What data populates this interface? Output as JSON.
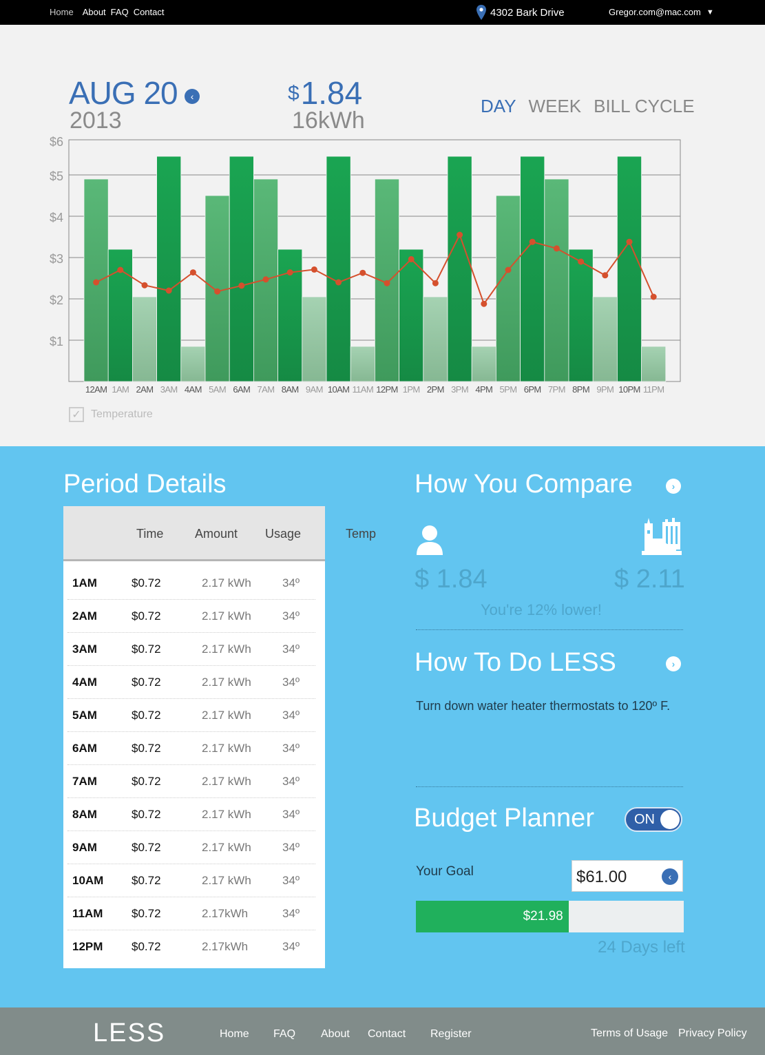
{
  "topbar": {
    "nav": [
      "Home",
      "About",
      "FAQ",
      "Contact"
    ],
    "address": "4302 Bark Drive",
    "user": "Gregor.com@mac.com",
    "caret": "▼"
  },
  "summary": {
    "date": "AUG 20",
    "year": "2013",
    "back_icon": "‹",
    "currency": "$",
    "amount": "1.84",
    "energy": "16kWh",
    "ranges": [
      "DAY",
      "WEEK",
      "BILL CYCLE"
    ],
    "active_range": "DAY"
  },
  "chart_data": {
    "type": "bar",
    "categories": [
      "12AM",
      "1AM",
      "2AM",
      "3AM",
      "4AM",
      "5AM",
      "6AM",
      "7AM",
      "8AM",
      "9AM",
      "10AM",
      "11AM",
      "12PM",
      "1PM",
      "2PM",
      "3PM",
      "4PM",
      "5PM",
      "6PM",
      "7PM",
      "8PM",
      "9PM",
      "10PM",
      "11PM"
    ],
    "values": [
      4.9,
      3.2,
      2.05,
      5.45,
      0.85,
      4.5,
      5.45,
      4.9,
      3.2,
      2.05,
      5.45,
      0.85,
      4.9,
      3.2,
      2.05,
      5.45,
      0.85,
      4.5,
      5.45,
      4.9,
      3.2,
      2.05,
      5.45,
      0.85
    ],
    "temperature_line": [
      2.4,
      2.7,
      2.33,
      2.2,
      2.64,
      2.18,
      2.32,
      2.47,
      2.64,
      2.71,
      2.4,
      2.63,
      2.38,
      2.96,
      2.38,
      3.55,
      1.88,
      2.7,
      3.38,
      3.22,
      2.9,
      2.57,
      3.38,
      2.05
    ],
    "yticks": [
      "$1",
      "$2",
      "$3",
      "$4",
      "$5",
      "$6"
    ],
    "ylim": [
      0,
      6
    ],
    "grid": true,
    "colors": {
      "bar_dark": "#1a9a4f",
      "bar_mid": "#3faa66",
      "bar_light": "#98c7a6",
      "line": "#d5502d"
    }
  },
  "temperature_toggle": {
    "label": "Temperature",
    "checked": true,
    "check_glyph": "✓"
  },
  "period": {
    "title": "Period Details",
    "headers": [
      "Time",
      "Amount",
      "Usage",
      "Temp"
    ],
    "rows": [
      [
        "1AM",
        "$0.72",
        "2.17 kWh",
        "34º"
      ],
      [
        "2AM",
        "$0.72",
        "2.17 kWh",
        "34º"
      ],
      [
        "3AM",
        "$0.72",
        "2.17 kWh",
        "34º"
      ],
      [
        "4AM",
        "$0.72",
        "2.17 kWh",
        "34º"
      ],
      [
        "5AM",
        "$0.72",
        "2.17 kWh",
        "34º"
      ],
      [
        "6AM",
        "$0.72",
        "2.17 kWh",
        "34º"
      ],
      [
        "7AM",
        "$0.72",
        "2.17 kWh",
        "34º"
      ],
      [
        "8AM",
        "$0.72",
        "2.17 kWh",
        "34º"
      ],
      [
        "9AM",
        "$0.72",
        "2.17 kWh",
        "34º"
      ],
      [
        "10AM",
        "$0.72",
        "2.17 kWh",
        "34º"
      ],
      [
        "11AM",
        "$0.72",
        "2.17kWh",
        "34º"
      ],
      [
        "12PM",
        "$0.72",
        "2.17kWh",
        "34º"
      ]
    ]
  },
  "compare": {
    "title": "How You Compare",
    "you": "$ 1.84",
    "others": "$ 2.11",
    "note": "You're 12% lower!",
    "arrow_icon": "›"
  },
  "less": {
    "title": "How To Do LESS",
    "tip": "Turn down water heater thermostats to 120º F.",
    "arrow_icon": "›"
  },
  "budget": {
    "title": "Budget Planner",
    "toggle": "ON",
    "goal_label": "Your Goal",
    "goal_value": "$61.00",
    "back_icon": "‹",
    "spent": "$21.98",
    "progress": 0.57,
    "days_left": "24 Days left"
  },
  "footer": {
    "logo": "LESS",
    "nav": [
      "Home",
      "FAQ",
      "About",
      "Contact",
      "Register"
    ],
    "legal": [
      "Terms of Usage",
      "Privacy Policy"
    ]
  }
}
